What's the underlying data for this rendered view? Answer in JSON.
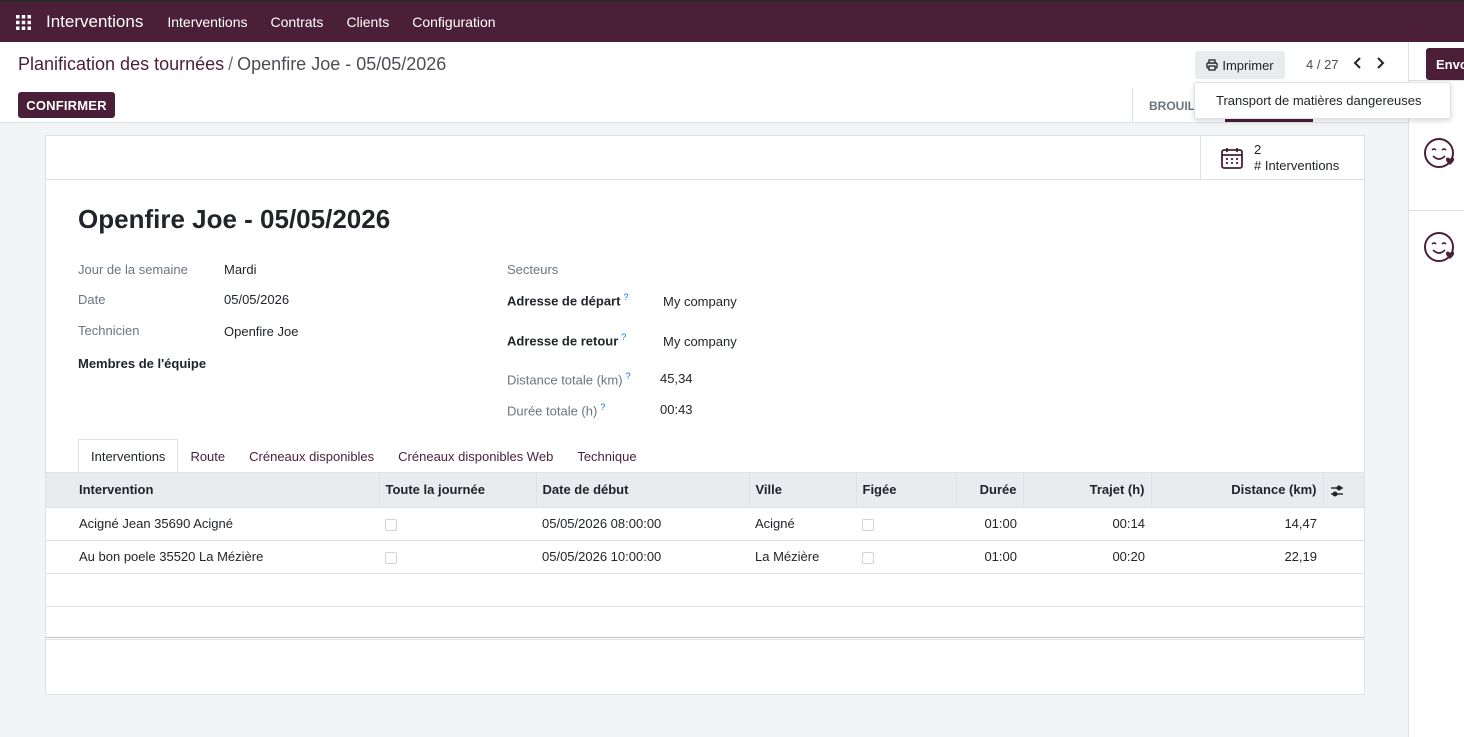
{
  "topbar": {
    "app_title": "Interventions",
    "menu": [
      "Interventions",
      "Contrats",
      "Clients",
      "Configuration"
    ]
  },
  "breadcrumb": {
    "parent": "Planification des tournées",
    "separator": "/",
    "current": "Openfire Joe - 05/05/2026"
  },
  "toolbar": {
    "print_label": "Imprimer",
    "pager": "4 / 27",
    "confirm_label": "CONFIRMER",
    "status_draft": "BROUILL",
    "print_dropdown_item": "Transport de matières dangereuses"
  },
  "chatter": {
    "send_label": "Envo"
  },
  "smart_button": {
    "value": "2",
    "label": "# Interventions"
  },
  "record": {
    "title": "Openfire Joe - 05/05/2026",
    "left_fields": [
      {
        "label": "Jour de la semaine",
        "value": "Mardi"
      },
      {
        "label": "Date",
        "value": "05/05/2026"
      },
      {
        "label": "Technicien",
        "value": "Openfire Joe"
      },
      {
        "label": "Membres de l'équipe",
        "value": ""
      }
    ],
    "right_fields": [
      {
        "label": "Secteurs",
        "value": ""
      },
      {
        "label": "Adresse de départ",
        "help": "?",
        "value": "My company"
      },
      {
        "label": "Adresse de retour",
        "help": "?",
        "value": "My company"
      },
      {
        "label": "Distance totale (km)",
        "help": "?",
        "value": "45,34"
      },
      {
        "label": "Durée totale (h)",
        "help": "?",
        "value": "00:43"
      }
    ]
  },
  "tabs": [
    "Interventions",
    "Route",
    "Créneaux disponibles",
    "Créneaux disponibles Web",
    "Technique"
  ],
  "table": {
    "columns": [
      "Intervention",
      "Toute la journée",
      "Date de début",
      "Ville",
      "Figée",
      "Durée",
      "Trajet (h)",
      "Distance (km)"
    ],
    "rows": [
      {
        "intervention": "Acigné Jean 35690 Acigné",
        "date": "05/05/2026 08:00:00",
        "city": "Acigné",
        "duration": "01:00",
        "travel": "00:14",
        "distance": "14,47"
      },
      {
        "intervention": "Au bon poele 35520 La Mézière",
        "date": "05/05/2026 10:00:00",
        "city": "La Mézière",
        "duration": "01:00",
        "travel": "00:20",
        "distance": "22,19"
      }
    ]
  },
  "colors": {
    "brand": "#4a1f37",
    "link": "#4a1f37",
    "help": "#0d6efd"
  }
}
